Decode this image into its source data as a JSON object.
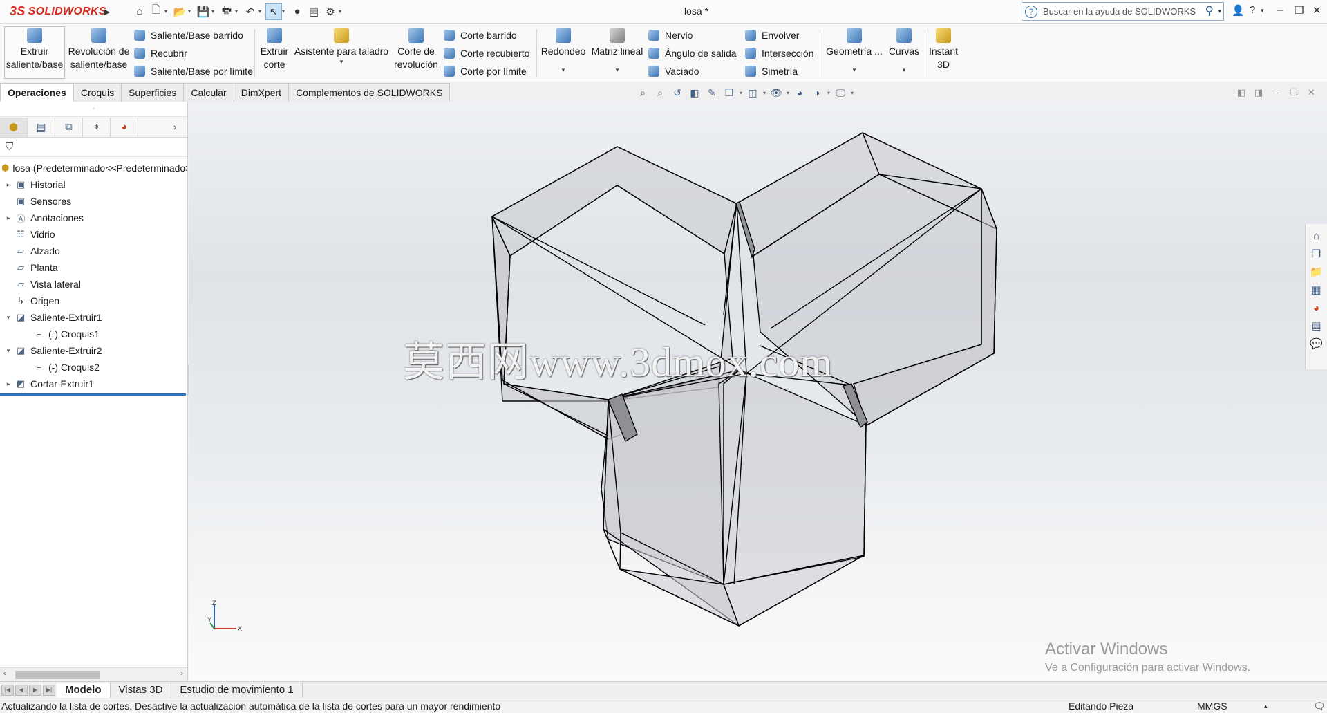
{
  "app": {
    "brand": "SOLIDWORKS",
    "brand_prefix": "3S",
    "document_title": "losa *",
    "help_search_placeholder": "Buscar en la ayuda de SOLIDWORKS"
  },
  "ribbon": {
    "extrude_boss_line1": "Extruir",
    "extrude_boss_line2": "saliente/base",
    "revolve_boss_line1": "Revolución de",
    "revolve_boss_line2": "saliente/base",
    "swept_boss": "Saliente/Base barrido",
    "lofted": "Recubrir",
    "boundary_boss": "Saliente/Base por límite",
    "extrude_cut_line1": "Extruir",
    "extrude_cut_line2": "corte",
    "hole_wizard": "Asistente para taladro",
    "revolve_cut_line1": "Corte de",
    "revolve_cut_line2": "revolución",
    "swept_cut": "Corte barrido",
    "lofted_cut": "Corte recubierto",
    "boundary_cut": "Corte por límite",
    "fillet": "Redondeo",
    "linear_pattern": "Matriz lineal",
    "rib": "Nervio",
    "draft": "Ángulo de salida",
    "shell": "Vaciado",
    "wrap": "Envolver",
    "intersect": "Intersección",
    "mirror": "Simetría",
    "reference_geometry": "Geometría ...",
    "curves": "Curvas",
    "instant3d_line1": "Instant",
    "instant3d_line2": "3D"
  },
  "command_tabs": [
    "Operaciones",
    "Croquis",
    "Superficies",
    "Calcular",
    "DimXpert",
    "Complementos de SOLIDWORKS"
  ],
  "feature_tree": {
    "root": "losa  (Predeterminado<<Predeterminado>",
    "items": [
      {
        "label": "Historial"
      },
      {
        "label": "Sensores"
      },
      {
        "label": "Anotaciones"
      },
      {
        "label": "Vidrio"
      },
      {
        "label": "Alzado"
      },
      {
        "label": "Planta"
      },
      {
        "label": "Vista lateral"
      },
      {
        "label": "Origen"
      },
      {
        "label": "Saliente-Extruir1"
      },
      {
        "label": "(-) Croquis1"
      },
      {
        "label": "Saliente-Extruir2"
      },
      {
        "label": "(-) Croquis2"
      },
      {
        "label": "Cortar-Extruir1"
      }
    ]
  },
  "viewport": {
    "watermark": "莫西网www.3dmox.com",
    "triad_z": "Z",
    "triad_y": "Y",
    "triad_x": "X",
    "activate_title": "Activar Windows",
    "activate_sub": "Ve a Configuración para activar Windows."
  },
  "bottom_tabs": [
    "Modelo",
    "Vistas 3D",
    "Estudio de movimiento 1"
  ],
  "status": {
    "message": "Actualizando la lista de cortes. Desactive la actualización automática de la lista de cortes para un mayor rendimiento",
    "mode": "Editando Pieza",
    "units": "MMGS"
  },
  "colors": {
    "brand_red": "#d52b1e",
    "model_face": "#c9cbcf",
    "model_edge": "#000000",
    "accent_blue": "#2f6fbf"
  }
}
